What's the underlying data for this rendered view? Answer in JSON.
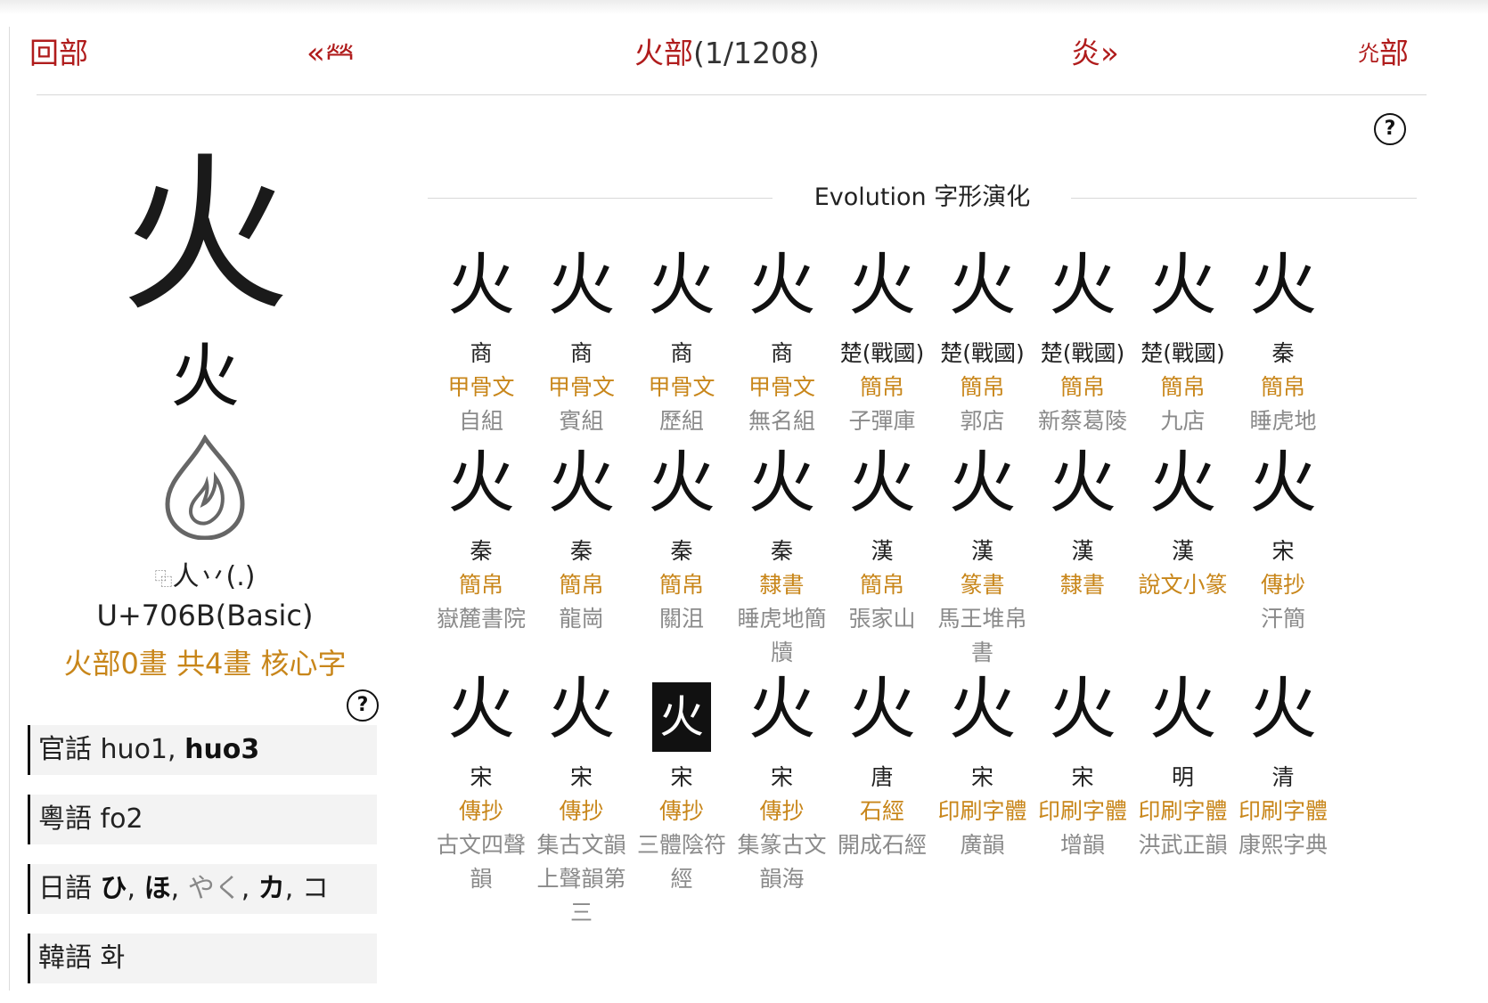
{
  "nav": {
    "radical_label": "回部",
    "prev_char": "𤇾",
    "current_radical": "火部",
    "current_count": "(1/1208)",
    "next_char": "炎",
    "next_radical_char": "灮",
    "next_radical_suffix": "部",
    "chevron_left": "«",
    "chevron_right": "»"
  },
  "character": {
    "big": "火",
    "seal": "火",
    "ids_prefix": "⿻",
    "ids": "人丷(.)",
    "codepoint": "U+706B(Basic)",
    "strokes": "火部0畫 共4畫 核心字"
  },
  "help_icon": "?",
  "readings": [
    {
      "lang": "官話",
      "parts": [
        {
          "t": "huo1, ",
          "s": "n"
        },
        {
          "t": "huo3",
          "s": "b"
        }
      ]
    },
    {
      "lang": "粵語",
      "parts": [
        {
          "t": "fo2",
          "s": "n"
        }
      ]
    },
    {
      "lang": "日語",
      "parts": [
        {
          "t": "ひ",
          "s": "b"
        },
        {
          "t": ", ",
          "s": "n"
        },
        {
          "t": "ほ",
          "s": "b"
        },
        {
          "t": ", ",
          "s": "n"
        },
        {
          "t": "やく",
          "s": "d"
        },
        {
          "t": ", ",
          "s": "n"
        },
        {
          "t": "カ",
          "s": "b"
        },
        {
          "t": ", ",
          "s": "n"
        },
        {
          "t": "コ",
          "s": "n"
        }
      ]
    },
    {
      "lang": "韓語",
      "parts": [
        {
          "t": "화",
          "s": "n"
        }
      ]
    }
  ],
  "evolution": {
    "title": "Evolution 字形演化",
    "rows": [
      [
        {
          "g": "火",
          "p": "商",
          "s": "甲骨文",
          "src": "自組"
        },
        {
          "g": "火",
          "p": "商",
          "s": "甲骨文",
          "src": "賓組"
        },
        {
          "g": "火",
          "p": "商",
          "s": "甲骨文",
          "src": "歷組"
        },
        {
          "g": "火",
          "p": "商",
          "s": "甲骨文",
          "src": "無名組"
        },
        {
          "g": "火",
          "p": "楚(戰國)",
          "s": "簡帛",
          "src": "子彈庫"
        },
        {
          "g": "火",
          "p": "楚(戰國)",
          "s": "簡帛",
          "src": "郭店"
        },
        {
          "g": "火",
          "p": "楚(戰國)",
          "s": "簡帛",
          "src": "新蔡葛陵"
        },
        {
          "g": "火",
          "p": "楚(戰國)",
          "s": "簡帛",
          "src": "九店"
        },
        {
          "g": "火",
          "p": "秦",
          "s": "簡帛",
          "src": "睡虎地"
        }
      ],
      [
        {
          "g": "火",
          "p": "秦",
          "s": "簡帛",
          "src": "嶽麓書院"
        },
        {
          "g": "火",
          "p": "秦",
          "s": "簡帛",
          "src": "龍崗"
        },
        {
          "g": "火",
          "p": "秦",
          "s": "簡帛",
          "src": "關沮"
        },
        {
          "g": "火",
          "p": "秦",
          "s": "隸書",
          "src": "睡虎地簡牘"
        },
        {
          "g": "火",
          "p": "漢",
          "s": "簡帛",
          "src": "張家山"
        },
        {
          "g": "火",
          "p": "漢",
          "s": "篆書",
          "src": "馬王堆帛書"
        },
        {
          "g": "火",
          "p": "漢",
          "s": "隸書",
          "src": ""
        },
        {
          "g": "火",
          "p": "漢",
          "s": "說文小篆",
          "src": ""
        },
        {
          "g": "火",
          "p": "宋",
          "s": "傳抄",
          "src": "汗簡"
        }
      ],
      [
        {
          "g": "火",
          "p": "宋",
          "s": "傳抄",
          "src": "古文四聲韻"
        },
        {
          "g": "火",
          "p": "宋",
          "s": "傳抄",
          "src": "集古文韻上聲韻第三"
        },
        {
          "g": "火",
          "p": "宋",
          "s": "傳抄",
          "src": "三體陰符經",
          "boxed": true
        },
        {
          "g": "火",
          "p": "宋",
          "s": "傳抄",
          "src": "集篆古文韻海"
        },
        {
          "g": "火",
          "p": "唐",
          "s": "石經",
          "src": "開成石經"
        },
        {
          "g": "火",
          "p": "宋",
          "s": "印刷字體",
          "src": "廣韻"
        },
        {
          "g": "火",
          "p": "宋",
          "s": "印刷字體",
          "src": "增韻"
        },
        {
          "g": "火",
          "p": "明",
          "s": "印刷字體",
          "src": "洪武正韻"
        },
        {
          "g": "火",
          "p": "清",
          "s": "印刷字體",
          "src": "康熙字典"
        }
      ]
    ]
  }
}
